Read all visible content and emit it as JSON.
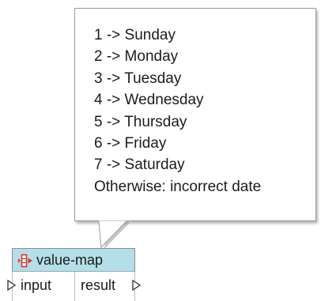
{
  "tooltip": {
    "lines": [
      "1 -> Sunday",
      "2 -> Monday",
      "3 -> Tuesday",
      "4 -> Wednesday",
      "5 -> Thursday",
      "6 -> Friday",
      "7 -> Saturday",
      "Otherwise: incorrect date"
    ]
  },
  "component": {
    "title": "value-map",
    "icon": "value-map-icon",
    "input_port_label": "input",
    "result_port_label": "result",
    "header_color": "#b4dfe8",
    "icon_color": "#d9342b"
  }
}
